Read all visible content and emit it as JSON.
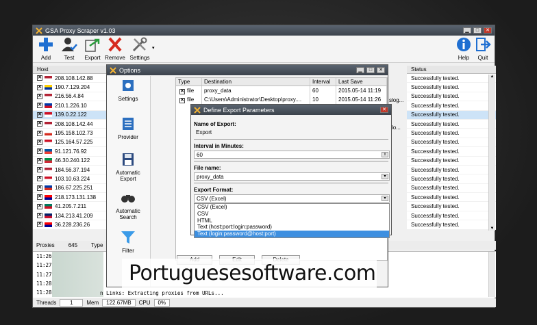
{
  "main": {
    "title": "GSA Proxy Scraper v1.03",
    "toolbar": {
      "add": "Add",
      "test": "Test",
      "export": "Export",
      "remove": "Remove",
      "settings": "Settings",
      "help": "Help",
      "quit": "Quit"
    },
    "host_header": "Host",
    "status_header": "Status",
    "hosts": [
      "208.108.142.88",
      "190.7.129.204",
      "216.56.4.84",
      "210.1.226.10",
      "139.0.22.122",
      "208.108.142.44",
      "195.158.102.73",
      "125.164.57.225",
      "91.121.76.92",
      "46.30.240.122",
      "184.56.37.194",
      "103.10.63.224",
      "186.67.225.251",
      "218.173.131.138",
      "41.205.7.211",
      "134.213.41.209",
      "36.228.236.26"
    ],
    "statuses": [
      "Successfully tested.",
      "Successfully tested.",
      "Successfully tested.",
      "Successfully tested.",
      "Successfully tested.",
      "Successfully tested.",
      "Successfully tested.",
      "Successfully tested.",
      "Successfully tested.",
      "Successfully tested.",
      "Successfully tested.",
      "Successfully tested.",
      "Successfully tested.",
      "Successfully tested.",
      "Successfully tested.",
      "Successfully tested.",
      "Successfully tested."
    ],
    "partial_texts": [
      "slog...",
      "slo...",
      "jo..."
    ],
    "proxies_label": "Proxies",
    "proxies_count": "645",
    "type_label": "Type",
    "log_times": [
      "11:26",
      "11:27",
      "11:27",
      "11:28",
      "11:28"
    ],
    "log_line": "n Links: Extracting proxies from URLs...",
    "footer": {
      "threads_label": "Threads",
      "threads": "1",
      "mem_label": "Mem",
      "mem": "122.67MB",
      "cpu_label": "CPU",
      "cpu": "0%"
    }
  },
  "options": {
    "title": "Options",
    "sidebar": [
      "Settings",
      "Provider",
      "Automatic Export",
      "Automatic Search",
      "Filter"
    ],
    "columns": [
      "Type",
      "Destination",
      "Interval",
      "Last Save"
    ],
    "rows": [
      {
        "type": "file",
        "destination": "proxy_data",
        "interval": "60",
        "last_save": "2015.05-14 11:19"
      },
      {
        "type": "file",
        "destination": "C:\\Users\\Administrator\\Desktop\\proxy....",
        "interval": "10",
        "last_save": "2015.05-14 11:26"
      }
    ],
    "add": "Add",
    "edit": "Edit",
    "delete": "Delete"
  },
  "export": {
    "title": "Define Export Parameters",
    "name_label": "Name of Export:",
    "name_value": "Export",
    "interval_label": "Interval in Minutes:",
    "interval_value": "60",
    "file_label": "File name:",
    "file_value": "proxy_data",
    "format_label": "Export Format:",
    "format_value": "CSV (Excel)",
    "format_options": [
      "CSV (Excel)",
      "CSV",
      "HTML",
      "Text (host:port:login:password)",
      "Text (login:password@host:port)"
    ]
  },
  "watermark": "Portuguesesoftware.com",
  "colors": {
    "titlebar": "#4a525c",
    "selection": "#3d8fe0",
    "close": "#c0392b"
  }
}
